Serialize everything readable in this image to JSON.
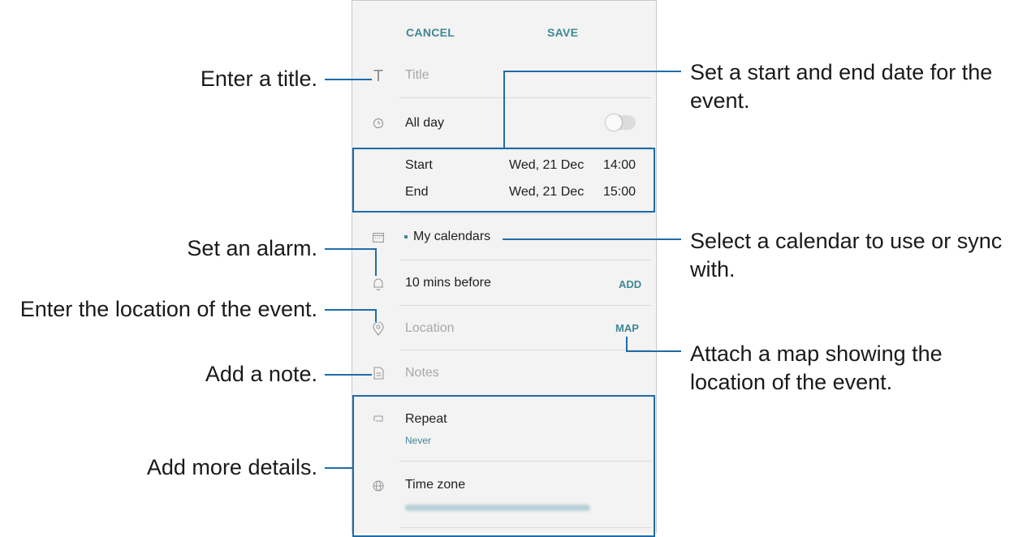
{
  "toolbar": {
    "cancel_label": "CANCEL",
    "save_label": "SAVE"
  },
  "form": {
    "title_placeholder": "Title",
    "all_day_label": "All day",
    "all_day_on": false,
    "start_label": "Start",
    "start_date": "Wed, 21 Dec",
    "start_time": "14:00",
    "end_label": "End",
    "end_date": "Wed, 21 Dec",
    "end_time": "15:00",
    "calendar_label": "My calendars",
    "calendar_color": "#3f8796",
    "alarm_label": "10 mins before",
    "add_label": "ADD",
    "location_placeholder": "Location",
    "map_label": "MAP",
    "notes_placeholder": "Notes",
    "repeat_label": "Repeat",
    "repeat_value": "Never",
    "timezone_label": "Time zone"
  },
  "icons": {
    "title": "title-text-icon",
    "all_day": "clock-icon",
    "calendar": "calendar-icon",
    "alarm": "bell-icon",
    "location": "location-pin-icon",
    "notes": "note-icon",
    "repeat": "repeat-icon",
    "timezone": "globe-icon"
  },
  "callouts": {
    "title": "Enter a title.",
    "dates_line1": "Set a start and end date for the",
    "dates_line2": "event.",
    "alarm": "Set an alarm.",
    "calendar_line1": "Select a calendar to use or sync",
    "calendar_line2": "with.",
    "location": "Enter the location of the event.",
    "map_line1": "Attach a map showing the",
    "map_line2": "location of the event.",
    "note": "Add a note.",
    "details": "Add more details."
  },
  "colors": {
    "accent": "#3f8796",
    "callout_line": "#1f6ca8",
    "screen_bg": "#f3f3f3"
  }
}
